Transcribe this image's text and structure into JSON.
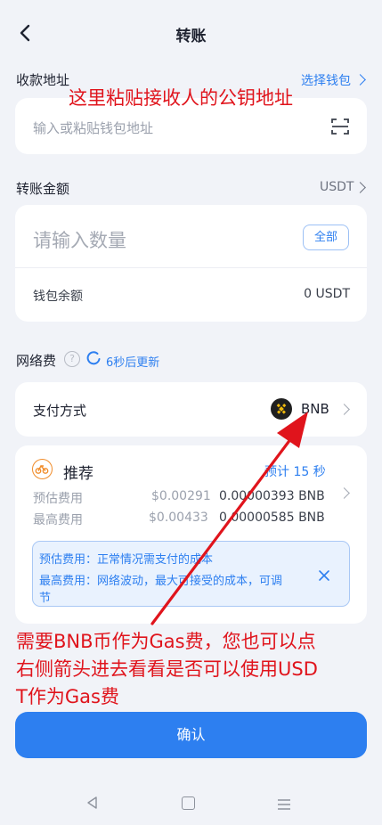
{
  "header": {
    "title": "转账"
  },
  "address": {
    "label": "收款地址",
    "select_wallet": "选择钱包",
    "placeholder": "输入或粘贴钱包地址"
  },
  "amount": {
    "label": "转账金额",
    "token": "USDT",
    "placeholder": "请输入数量",
    "all_button": "全部",
    "balance_label": "钱包余额",
    "balance_value": "0 USDT"
  },
  "fee": {
    "label": "网络费",
    "refresh_text": "6秒后更新",
    "pay_method_label": "支付方式",
    "pay_token": "BNB",
    "recommend_label": "推荐",
    "eta": "预计 15 秒",
    "est_label": "预估费用",
    "est_usd": "$0.00291",
    "est_token": "0.00000393 BNB",
    "max_label": "最高费用",
    "max_usd": "$0.00433",
    "max_token": "0.00000585 BNB",
    "info_line1": "预估费用：正常情况需支付的成本",
    "info_line2a": "最高费用：网络波动，最大可接受的成本，可调",
    "info_line2b": "节"
  },
  "confirm_button": "确认",
  "annotations": {
    "top": "这里粘贴接收人的公钥地址",
    "bottom_line1": "需要BNB币作为Gas费，您也可以点",
    "bottom_line2": "右侧箭头进去看看是否可以使用USD",
    "bottom_line3": "T作为Gas费"
  },
  "colors": {
    "accent": "#2d7ff0",
    "annotation": "#e0141c",
    "bnb": "#f0b90b",
    "recommend": "#f08c2a"
  }
}
